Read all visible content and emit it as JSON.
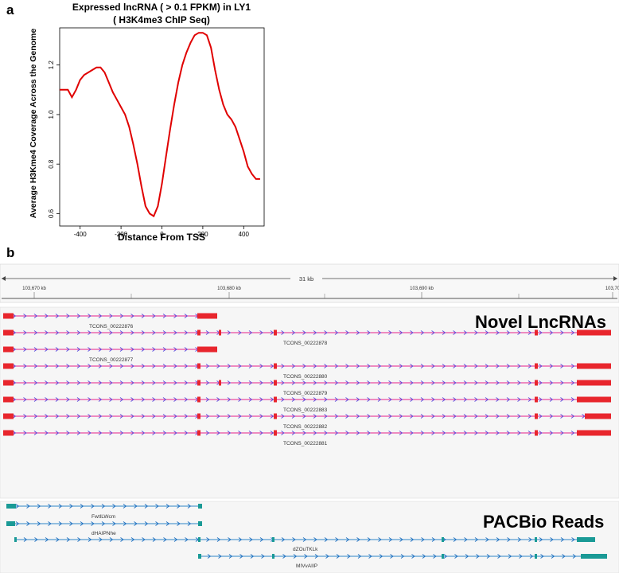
{
  "panel_a": {
    "letter": "a",
    "title_line1": "Expressed lncRNA ( > 0.1 FPKM) in LY1",
    "title_line2": "( H3K4me3 ChIP Seq)"
  },
  "chart_data": {
    "type": "line",
    "title": "Expressed lncRNA ( > 0.1 FPKM) in LY1 ( H3K4me3 ChIP Seq)",
    "xlabel": "Distance From TSS",
    "ylabel": "Average H3Kme4 Coverage Across the Genome",
    "xlim": [
      -500,
      500
    ],
    "ylim": [
      0.55,
      1.35
    ],
    "xticks": [
      "-400",
      "-200",
      "0",
      "200",
      "400"
    ],
    "yticks": [
      "0.6",
      "0.8",
      "1.0",
      "1.2"
    ],
    "series": [
      {
        "color": "#e00000",
        "x": [
          -500,
          -480,
          -460,
          -440,
          -420,
          -400,
          -380,
          -360,
          -340,
          -320,
          -300,
          -280,
          -260,
          -240,
          -220,
          -200,
          -180,
          -160,
          -140,
          -120,
          -100,
          -80,
          -60,
          -40,
          -20,
          0,
          20,
          40,
          60,
          80,
          100,
          120,
          140,
          160,
          180,
          200,
          220,
          240,
          260,
          280,
          300,
          320,
          340,
          360,
          380,
          400,
          420,
          440,
          460,
          480
        ],
        "y": [
          1.1,
          1.1,
          1.1,
          1.07,
          1.1,
          1.14,
          1.16,
          1.17,
          1.18,
          1.19,
          1.19,
          1.17,
          1.13,
          1.09,
          1.06,
          1.03,
          1.0,
          0.95,
          0.88,
          0.8,
          0.71,
          0.63,
          0.6,
          0.59,
          0.63,
          0.72,
          0.83,
          0.94,
          1.04,
          1.13,
          1.2,
          1.25,
          1.29,
          1.32,
          1.33,
          1.33,
          1.32,
          1.27,
          1.18,
          1.1,
          1.04,
          1.0,
          0.98,
          0.95,
          0.9,
          0.85,
          0.79,
          0.76,
          0.74,
          0.74
        ]
      }
    ]
  },
  "panel_b": {
    "letter": "b",
    "ruler": {
      "span_label": "31 kb",
      "positions": [
        "103,670 kb",
        "103,680 kb",
        "103,690 kb",
        "103,70"
      ]
    },
    "lncrna_section_label": "Novel LncRNAs",
    "pacbio_section_label": "PACBio Reads",
    "lncrna_tracks": [
      {
        "label": "TCONS_00222876"
      },
      {
        "label": "TCONS_00222878"
      },
      {
        "label": "TCONS_00222877"
      },
      {
        "label": "TCONS_00222880"
      },
      {
        "label": "TCONS_00222879"
      },
      {
        "label": "TCONS_00222883"
      },
      {
        "label": "TCONS_00222882"
      },
      {
        "label": "TCONS_00222881"
      }
    ],
    "pacbio_tracks": [
      {
        "label": "FwtILWcm"
      },
      {
        "label": "dHAIPNhe"
      },
      {
        "label": "dZOuTKLk"
      },
      {
        "label": "MIVvAIIP"
      }
    ],
    "colors": {
      "lncrna_exon": "#e8262d",
      "lncrna_line": "#e6208a",
      "lncrna_arrow": "#5a4fe0",
      "pacbio_exon": "#1a9a96",
      "pacbio_line": "#2e86c8",
      "pacbio_arrow": "#1f6fc0"
    }
  }
}
